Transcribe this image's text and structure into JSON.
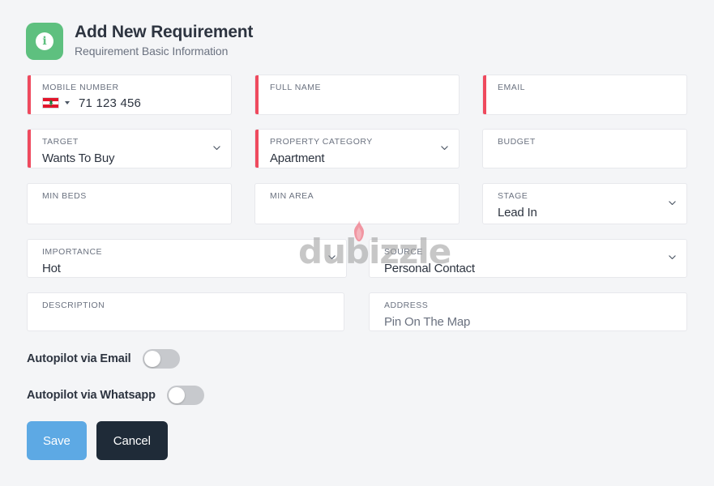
{
  "header": {
    "icon": "info-icon",
    "title": "Add New Requirement",
    "subtitle": "Requirement Basic Information",
    "badge_color": "#5ec07f"
  },
  "watermark": {
    "text": "dubizzle",
    "flame_color": "#ef4a5e",
    "text_color": "#9b9b9b"
  },
  "fields": {
    "mobile_number": {
      "label": "MOBILE NUMBER",
      "value": "71 123 456",
      "placeholder": "",
      "required": true,
      "country_flag": "lebanon-flag",
      "has_country_select": true
    },
    "full_name": {
      "label": "FULL NAME",
      "value": "",
      "placeholder": "",
      "required": true
    },
    "email": {
      "label": "EMAIL",
      "value": "",
      "placeholder": "",
      "required": true
    },
    "target": {
      "label": "TARGET",
      "value": "Wants To Buy",
      "required": true,
      "is_select": true
    },
    "property_category": {
      "label": "PROPERTY CATEGORY",
      "value": "Apartment",
      "required": true,
      "is_select": true
    },
    "budget": {
      "label": "BUDGET",
      "value": "",
      "placeholder": "",
      "required": false
    },
    "min_beds": {
      "label": "MIN BEDS",
      "value": "",
      "placeholder": "",
      "required": false
    },
    "min_area": {
      "label": "MIN AREA",
      "value": "",
      "placeholder": "",
      "required": false
    },
    "stage": {
      "label": "STAGE",
      "value": "Lead In",
      "required": false,
      "is_select": true
    },
    "importance": {
      "label": "IMPORTANCE",
      "value": "Hot",
      "required": false,
      "is_select": true
    },
    "source": {
      "label": "SOURCE",
      "value": "Personal Contact",
      "required": false,
      "is_select": true
    },
    "description": {
      "label": "DESCRIPTION",
      "value": "",
      "placeholder": "",
      "required": false
    },
    "address": {
      "label": "ADDRESS",
      "value": "Pin On The Map",
      "required": false
    }
  },
  "toggles": [
    {
      "label": "Autopilot via Email",
      "on": false
    },
    {
      "label": "Autopilot via Whatsapp",
      "on": false
    }
  ],
  "actions": {
    "save_label": "Save",
    "cancel_label": "Cancel",
    "save_color": "#5da9e4",
    "cancel_color": "#1f2b38"
  },
  "colors": {
    "background": "#f4f5f7",
    "field_background": "#ffffff",
    "required_bar": "#ef4a5e",
    "label_text": "#6b7280",
    "value_text": "#2d3440"
  }
}
